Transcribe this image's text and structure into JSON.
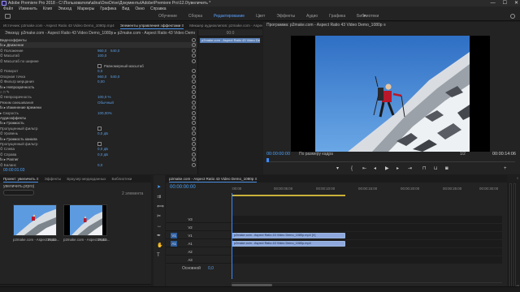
{
  "window": {
    "title": "Adobe Premiere Pro 2018 - C:\\Пользователи\\alina\\OneDrive\\Документы\\Adobe\\Premiere Pro\\12.0\\увеличить *",
    "controls": [
      "—",
      "☐",
      "✕"
    ]
  },
  "menu": [
    "Файл",
    "Изменить",
    "Клип",
    "Эпизод",
    "Маркеры",
    "Графика",
    "Вид",
    "Окно",
    "Справка"
  ],
  "workspaces": {
    "tabs": [
      "Обучение",
      "Сборка",
      "Редактирование",
      "Цвет",
      "Эффекты",
      "Аудио",
      "Графика",
      "Библиотеки"
    ],
    "active": "Редактирование",
    "more": "»"
  },
  "effect_controls": {
    "tabs": [
      "Источник: p2make.com - Aspect Ratio 43 Video Demo_1080p.mp4",
      "Элементы управления эффектами ≡",
      "Микшер аудиоклипов: p2make.com - Aspect Ratio 43 Video Demo_1080p"
    ],
    "active_tab": "Элементы управления эффектами ≡",
    "sequence_header": "Эпизод: p2make.com - Aspect Ratio 43 Video Demo_1080p  ▸  p2make.com - Aspect Ratio 43 Video Demo_1080p.mp4",
    "timeline_ruler": "00:0",
    "clip_tag": "p2make.com - Aspect Ratio 43 Video Demo_1080p",
    "rows": [
      {
        "name": "Видеоэффекты",
        "section": true
      },
      {
        "name": "fx  ▸  Движение",
        "section": true,
        "highlight": true
      },
      {
        "name": "      ⏱ Положение",
        "v": "960,0",
        "v2": "540,0"
      },
      {
        "name": "      ⏱ Масштаб",
        "v": "100,0"
      },
      {
        "name": "      ⏱ Масштаб по ширине",
        "v": ""
      },
      {
        "name": "",
        "checkbox": true,
        "check_label": "Равномерный масштаб"
      },
      {
        "name": "      ⏱ Поворот",
        "v": "0,0"
      },
      {
        "name": "        Опорная точка",
        "v": "960,0",
        "v2": "540,0"
      },
      {
        "name": "      ⏱ Фильтр мерцания",
        "v": "0,00"
      },
      {
        "name": "fx  ▸  Непрозрачность",
        "section": true
      },
      {
        "name": "      ○ □ ✎",
        "v": ""
      },
      {
        "name": "      ⏱ Непрозрачность",
        "v": "100,0 %"
      },
      {
        "name": "        Режим смешивания",
        "v": "Обычный"
      },
      {
        "name": "fx  ▸  Изменение времени",
        "section": true
      },
      {
        "name": "      ▸ Скорость",
        "v": "100,00%"
      },
      {
        "name": "Аудиоэффекты",
        "section": true
      },
      {
        "name": "fx  ▸  Громкость",
        "section": true
      },
      {
        "name": "        Пропущенный фильтр",
        "checkbox_at": true
      },
      {
        "name": "      ⏱ Уровень",
        "v": "0,0 дБ"
      },
      {
        "name": "fx  ▸  Громкость канала",
        "section": true
      },
      {
        "name": "        Пропущенный фильтр",
        "checkbox_at": true
      },
      {
        "name": "      ⏱ Слева",
        "v": "0,0 дБ"
      },
      {
        "name": "      ⏱ Справа",
        "v": "0,0 дБ"
      },
      {
        "name": "fx  ▸  Panner",
        "section": true
      },
      {
        "name": "      ⏱ Баланс",
        "v": "0,0"
      }
    ],
    "timecode": "00:00:01:03"
  },
  "program_monitor": {
    "title": "Программа: p2make.com - Aspect Ratio 43 Video Demo_1080p ≡",
    "timecode": "00:00:00:00",
    "fit": "По размеру кадра",
    "quality": "1/2",
    "duration": "00:00:14:06"
  },
  "project": {
    "tabs": [
      "Проект: увеличить ≡",
      "Эффекты",
      "Браузер медиаданных",
      "Библиотеки"
    ],
    "active_tab": "Проект: увеличить ≡",
    "file": "увеличить.prproj",
    "count": "2 элемента",
    "items": [
      {
        "label": "p2make.com - Aspect Ratio...",
        "duration": "14;10"
      },
      {
        "label": "p2make.com - Aspect Ratio...",
        "duration": "14;10"
      }
    ]
  },
  "timeline": {
    "tab": "p2make.com - Aspect Ratio 43 Video Demo_1080p ≡",
    "timecode": "00:00:00:00",
    "ruler": [
      ":00:00",
      "00:00:05:00",
      "00:00:10:00",
      "00:00:15:00",
      "00:00:20:00",
      "00:00:25:00",
      "00:00:30:00"
    ],
    "tracks": [
      {
        "name": "V3",
        "src": ""
      },
      {
        "name": "V2",
        "src": ""
      },
      {
        "name": "V1",
        "src": "V1",
        "clip": "p2make.com - Aspect Ratio 43 Video Demo_1080p.mp4 [V]"
      },
      {
        "name": "A1",
        "src": "A1",
        "clip": "p2make.com - Aspect Ratio 43 Video Demo_1080p.mp4"
      },
      {
        "name": "A2",
        "src": ""
      },
      {
        "name": "A3",
        "src": ""
      }
    ],
    "master_label": "Основной",
    "master_value": "0,0"
  },
  "meters": {
    "scale": [
      "0",
      "-12",
      "-24",
      "-36",
      "-48",
      "dB"
    ]
  }
}
